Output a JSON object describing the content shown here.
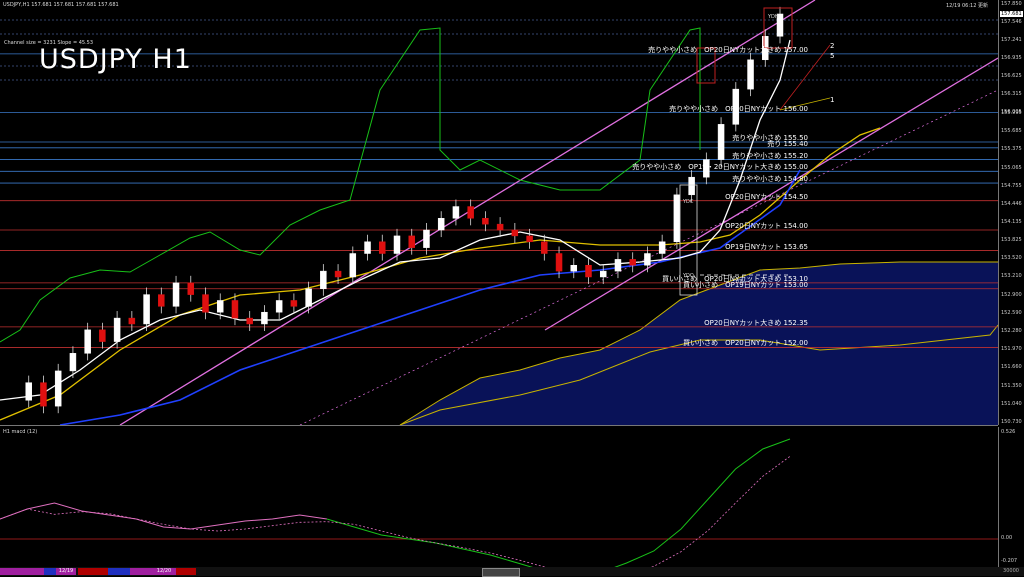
{
  "header": {
    "symbol_line": "USDJPY,H1  157.681 157.681 157.681 157.681",
    "channel_info": "Channel size = 3231 Slope = 45.53",
    "big_title": "USDJPY H1",
    "datetime": "12/19 06:12",
    "status": "更新"
  },
  "price_axis": [
    "157.850",
    "157.546",
    "157.241",
    "156.935",
    "156.625",
    "156.315",
    "156.005",
    "155.995",
    "155.685",
    "155.375",
    "155.065",
    "154.755",
    "154.446",
    "154.135",
    "153.825",
    "153.520",
    "153.210",
    "152.900",
    "152.590",
    "152.280",
    "151.970",
    "151.660",
    "151.350",
    "151.040",
    "150.730"
  ],
  "current_price": "157.681",
  "levels": [
    {
      "price": 157.0,
      "text": "売りやや小さめ　OP20日NYカット大きめ 157.00",
      "color": "#3a78c8"
    },
    {
      "price": 156.0,
      "text": "売りやや小さめ　OP20日NYカット 156.00",
      "color": "#3a78c8"
    },
    {
      "price": 155.5,
      "text": "売りやや小さめ 155.50",
      "color": "#3a78c8"
    },
    {
      "price": 155.4,
      "text": "売り 155.40",
      "color": "#3a78c8"
    },
    {
      "price": 155.2,
      "text": "売りやや小さめ 155.20",
      "color": "#3a78c8"
    },
    {
      "price": 155.0,
      "text": "売りやや小さめ　OP19・20日NYカット大きめ 155.00",
      "color": "#3a78c8"
    },
    {
      "price": 154.8,
      "text": "売りやや小さめ 154.80",
      "color": "#3a78c8"
    },
    {
      "price": 154.5,
      "text": "OP20日NYカット 154.50",
      "color": "#c03030"
    },
    {
      "price": 154.0,
      "text": "OP20日NYカット 154.00",
      "color": "#c03030"
    },
    {
      "price": 153.65,
      "text": "OP19日NYカット 153.65",
      "color": "#c03030"
    },
    {
      "price": 153.1,
      "text": "買い小さめ　OP20日NYカット大きめ 153.10",
      "color": "#c03030"
    },
    {
      "price": 153.0,
      "text": "買い小さめ　OP19日NYカット 153.00",
      "color": "#c03030"
    },
    {
      "price": 152.35,
      "text": "OP20日NYカット大きめ 152.35",
      "color": "#c03030"
    },
    {
      "price": 152.0,
      "text": "買い小さめ　OP20日NYカット 152.00",
      "color": "#c03030"
    }
  ],
  "markers": {
    "ydc": "YDC",
    "ydo": "YDO",
    "ydl": "YDL",
    "ydh": "YDH",
    "line_labels": [
      "2",
      "5",
      "1"
    ]
  },
  "indicator": {
    "title": "H1  macd (12)",
    "axis_top": "0.526",
    "axis_zero": "0.00",
    "axis_bottom": "-0.207"
  },
  "bottom_bar": {
    "date1": "12/19",
    "date2": "12/20",
    "right_value": "30000"
  },
  "chart_data": {
    "type": "candlestick",
    "title": "USDJPY H1",
    "ylim": [
      150.73,
      157.85
    ],
    "close_path": [
      151.1,
      151.4,
      151.0,
      151.6,
      151.9,
      152.3,
      152.1,
      152.5,
      152.4,
      152.9,
      152.7,
      153.1,
      152.9,
      152.6,
      152.8,
      152.5,
      152.4,
      152.6,
      152.8,
      152.7,
      153.0,
      153.3,
      153.2,
      153.6,
      153.8,
      153.6,
      153.9,
      153.7,
      154.0,
      154.2,
      154.4,
      154.2,
      154.1,
      154.0,
      153.9,
      153.8,
      153.6,
      153.3,
      153.4,
      153.2,
      153.3,
      153.5,
      153.4,
      153.6,
      153.8,
      154.6,
      154.9,
      155.2,
      155.8,
      156.4,
      156.9,
      157.3,
      157.68
    ],
    "macd": [
      0.1,
      0.15,
      0.18,
      0.14,
      0.12,
      0.1,
      0.06,
      0.05,
      0.07,
      0.09,
      0.1,
      0.12,
      0.1,
      0.06,
      0.02,
      0.0,
      -0.02,
      -0.05,
      -0.08,
      -0.12,
      -0.16,
      -0.2,
      -0.17,
      -0.12,
      -0.06,
      0.05,
      0.2,
      0.35,
      0.45,
      0.5
    ]
  }
}
